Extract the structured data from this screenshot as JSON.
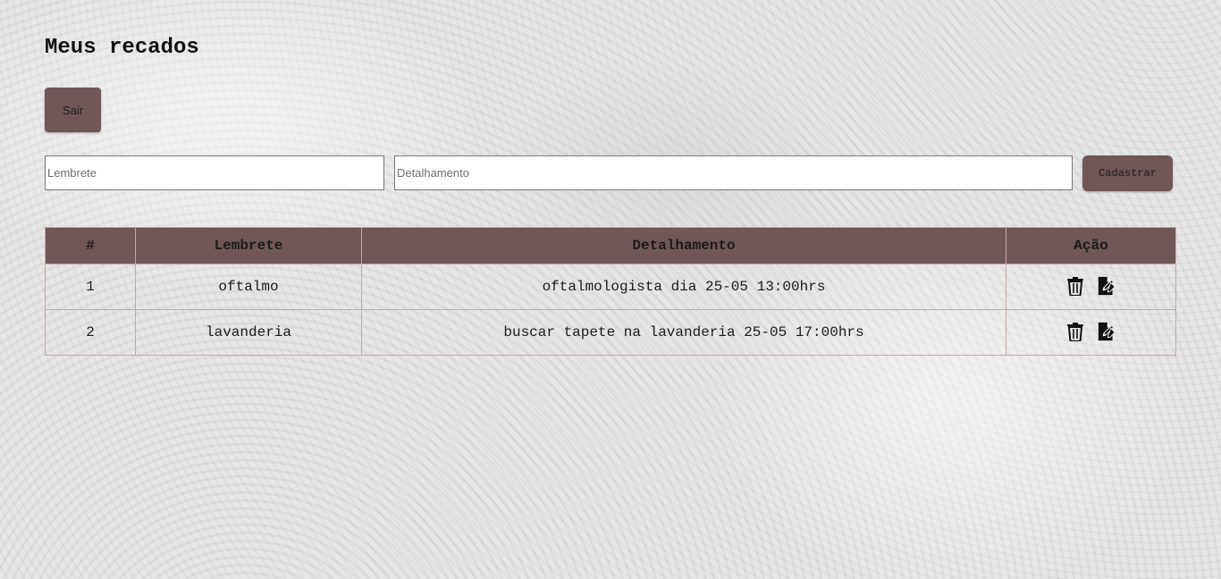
{
  "header": {
    "title": "Meus recados",
    "logout_label": "Sair"
  },
  "form": {
    "lembrete_placeholder": "Lembrete",
    "lembrete_value": "",
    "detalhamento_placeholder": "Detalhamento",
    "detalhamento_value": "",
    "submit_label": "Cadastrar"
  },
  "table": {
    "columns": [
      "#",
      "Lembrete",
      "Detalhamento",
      "Ação"
    ],
    "rows": [
      {
        "num": "1",
        "lembrete": "oftalmo",
        "detalhamento": "oftalmologista dia 25-05 13:00hrs",
        "actions": [
          "trash-icon",
          "edit-document-icon"
        ]
      },
      {
        "num": "2",
        "lembrete": "lavanderia",
        "detalhamento": "buscar tapete na lavanderia 25-05 17:00hrs",
        "actions": [
          "trash-icon",
          "edit-document-icon"
        ]
      }
    ]
  },
  "colors": {
    "accent": "#6f5758",
    "table_border": "#c9a5a6"
  }
}
